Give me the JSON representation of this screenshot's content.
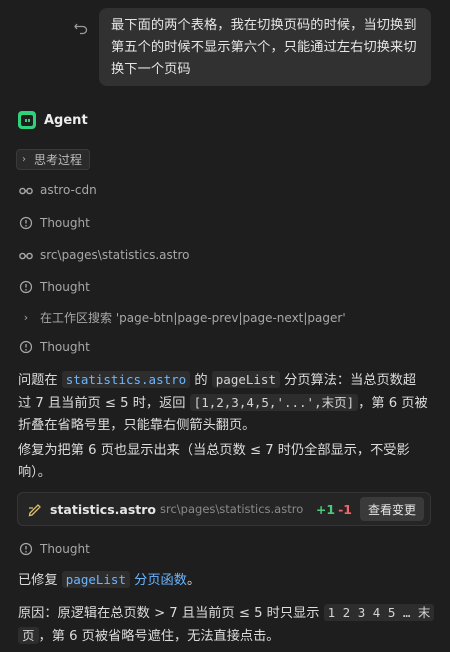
{
  "user_message": {
    "line1": "最下面的两个表格，我在切换页码的时候，当切换到",
    "line2": "第五个的时候不显示第六个，只能通过左右切换来切",
    "line3": "换下一个页码"
  },
  "agent": {
    "title": "Agent"
  },
  "steps": {
    "thinking_process": "思考过程",
    "astro_cdn": "astro-cdn",
    "thought1": "Thought",
    "stats_path": "src\\pages\\statistics.astro",
    "thought2": "Thought",
    "search": "在工作区搜索 'page-btn|page-prev|page-next|pager'",
    "thought3": "Thought",
    "thought4": "Thought"
  },
  "para1": {
    "a": "问题在 ",
    "code1": "statistics.astro",
    "b": " 的 ",
    "code2": "pageList",
    "c": " 分页算法：当总页数超",
    "d": "过 7 且当前页 ≤ 5 时，返回 ",
    "code3": "[1,2,3,4,5,'...',末页]",
    "e": "，第 6 页被",
    "f": "折叠在省略号里，只能靠右侧箭头翻页。"
  },
  "para2": {
    "line1": "修复为把第 6 页也显示出来（当总页数 ≤ 7 时仍全部显示，不受影",
    "line2": "响）。"
  },
  "file_card": {
    "name": "statistics.astro",
    "path": "src\\pages\\statistics.astro",
    "added": "+1",
    "removed": "-1",
    "view_button": "查看变更"
  },
  "para3": {
    "a": "已修复 ",
    "code": "pageList",
    "b": " 分页函数",
    "c": "。"
  },
  "para4": {
    "a": "原因：原逻辑在总页数 > 7 且当前页 ≤ 5 时只显示 ",
    "code": "1 2 3 4 5 … 末",
    "code2": "页",
    "b": "，第 6 页被省略号遮住，无法直接点击。"
  },
  "colors": {
    "background": "#1e1e1e",
    "bubble": "#313131",
    "agent_accent": "#2fd27a",
    "link": "#6cb6ff",
    "added": "#4ec97b",
    "removed": "#f06767"
  }
}
